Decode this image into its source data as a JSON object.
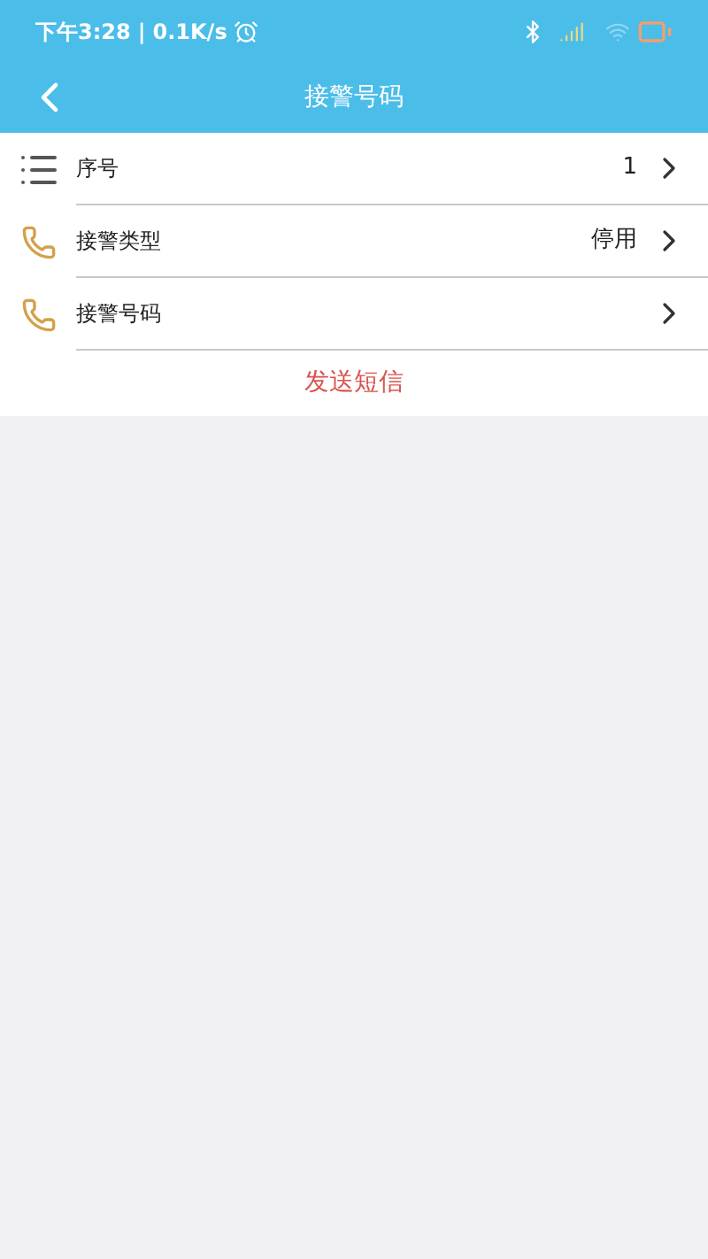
{
  "status_bar": {
    "time": "下午3:28",
    "separator": "|",
    "speed": "0.1K/s"
  },
  "header": {
    "title": "接警号码"
  },
  "rows": [
    {
      "kind": "list",
      "label": "序号",
      "value": "1"
    },
    {
      "kind": "phone",
      "label": "接警类型",
      "value": "停用"
    },
    {
      "kind": "phone",
      "label": "接警号码"
    }
  ],
  "action": "发送短信"
}
